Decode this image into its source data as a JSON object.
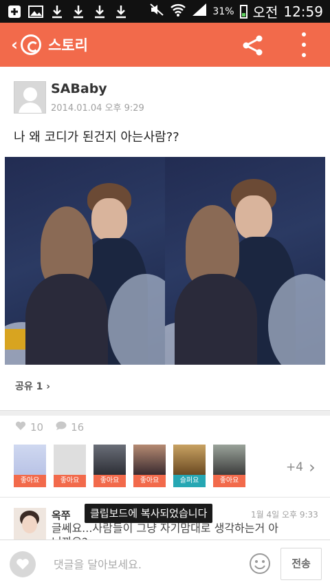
{
  "statusbar": {
    "battery_percent": "31%",
    "ampm": "오전",
    "time": "12:59",
    "icons": [
      "plus-box-icon",
      "image-icon",
      "download-icon",
      "download-icon",
      "download-icon",
      "download-icon",
      "mute-icon",
      "wifi-icon",
      "signal-icon",
      "battery-icon"
    ]
  },
  "appbar": {
    "title": "스토리",
    "icons": [
      "back-icon",
      "kakaostory-logo-icon",
      "share-icon",
      "more-icon"
    ],
    "color": "#f26a4b"
  },
  "post": {
    "author": "SABaby",
    "date": "2014.01.04 오후 9:29",
    "text": "나 왜 코디가 된건지 아는사람??",
    "share_label": "공유 1"
  },
  "stats": {
    "likes": "10",
    "comments": "16"
  },
  "likers": [
    {
      "badge": "좋아요",
      "type": "like"
    },
    {
      "badge": "좋아요",
      "type": "like"
    },
    {
      "badge": "좋아요",
      "type": "like"
    },
    {
      "badge": "좋아요",
      "type": "like"
    },
    {
      "badge": "슬퍼요",
      "type": "sad"
    },
    {
      "badge": "좋아요",
      "type": "like"
    }
  ],
  "likers_more": "+4",
  "comment": {
    "author": "옥쭈",
    "date": "1월 4일 오후 9:33",
    "text": "글쎄요...사람들이 그냥 자기맘대로 생각하는거 아니까요?"
  },
  "toast": "클립보드에 복사되었습니다",
  "compose": {
    "placeholder": "댓글을 달아보세요.",
    "send_label": "전송"
  }
}
